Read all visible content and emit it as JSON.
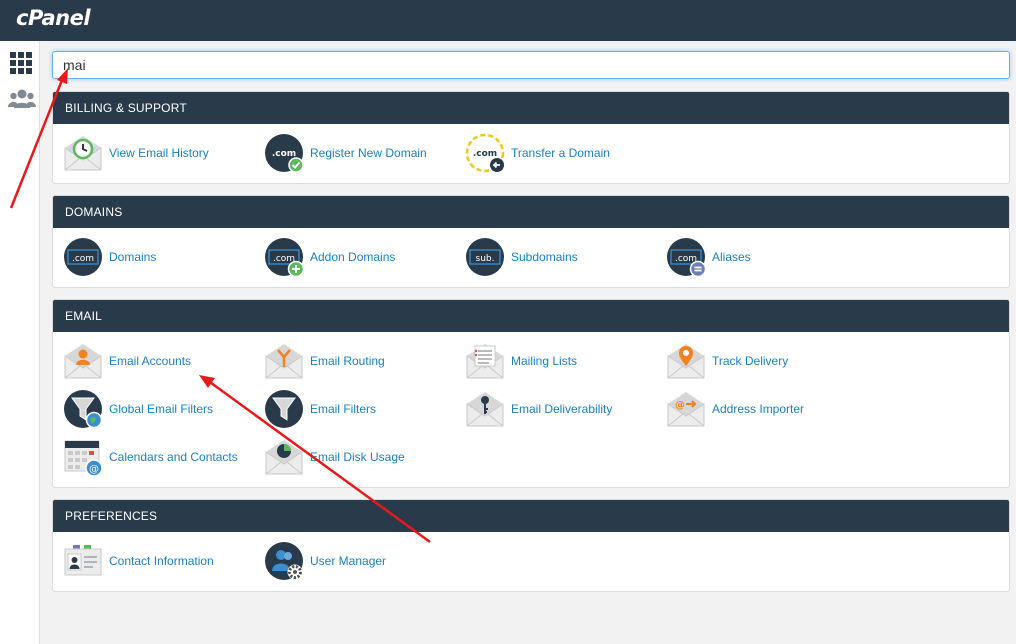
{
  "app": {
    "logo": "cPanel"
  },
  "sidebar": {
    "items": [
      {
        "name": "tools",
        "icon": "grid-icon"
      },
      {
        "name": "users",
        "icon": "users-icon"
      }
    ]
  },
  "search": {
    "value": "mai"
  },
  "colors": {
    "header": "#293a4a",
    "link": "#1b7fbd",
    "accent_green": "#5cb85c",
    "accent_orange": "#f5821f",
    "annotation_red": "#e8191b"
  },
  "sections": {
    "billing": {
      "title": "BILLING & SUPPORT",
      "items": [
        {
          "label": "View Email History",
          "icon": "email-history-icon"
        },
        {
          "label": "Register New Domain",
          "icon": "register-domain-icon"
        },
        {
          "label": "Transfer a Domain",
          "icon": "transfer-domain-icon"
        }
      ]
    },
    "domains": {
      "title": "DOMAINS",
      "items": [
        {
          "label": "Domains",
          "icon": "domains-icon",
          "badge": ".com"
        },
        {
          "label": "Addon Domains",
          "icon": "addon-domains-icon",
          "badge": ".com"
        },
        {
          "label": "Subdomains",
          "icon": "subdomains-icon",
          "badge": "sub."
        },
        {
          "label": "Aliases",
          "icon": "aliases-icon",
          "badge": ".com"
        }
      ]
    },
    "email": {
      "title": "EMAIL",
      "items": [
        {
          "label": "Email Accounts",
          "icon": "email-accounts-icon"
        },
        {
          "label": "Email Routing",
          "icon": "email-routing-icon"
        },
        {
          "label": "Mailing Lists",
          "icon": "mailing-lists-icon"
        },
        {
          "label": "Track Delivery",
          "icon": "track-delivery-icon"
        },
        {
          "label": "Global Email Filters",
          "icon": "global-email-filters-icon"
        },
        {
          "label": "Email Filters",
          "icon": "email-filters-icon"
        },
        {
          "label": "Email Deliverability",
          "icon": "email-deliverability-icon"
        },
        {
          "label": "Address Importer",
          "icon": "address-importer-icon"
        },
        {
          "label": "Calendars and Contacts",
          "icon": "calendars-contacts-icon"
        },
        {
          "label": "Email Disk Usage",
          "icon": "email-disk-usage-icon"
        }
      ]
    },
    "preferences": {
      "title": "PREFERENCES",
      "items": [
        {
          "label": "Contact Information",
          "icon": "contact-information-icon"
        },
        {
          "label": "User Manager",
          "icon": "user-manager-icon"
        }
      ]
    }
  }
}
